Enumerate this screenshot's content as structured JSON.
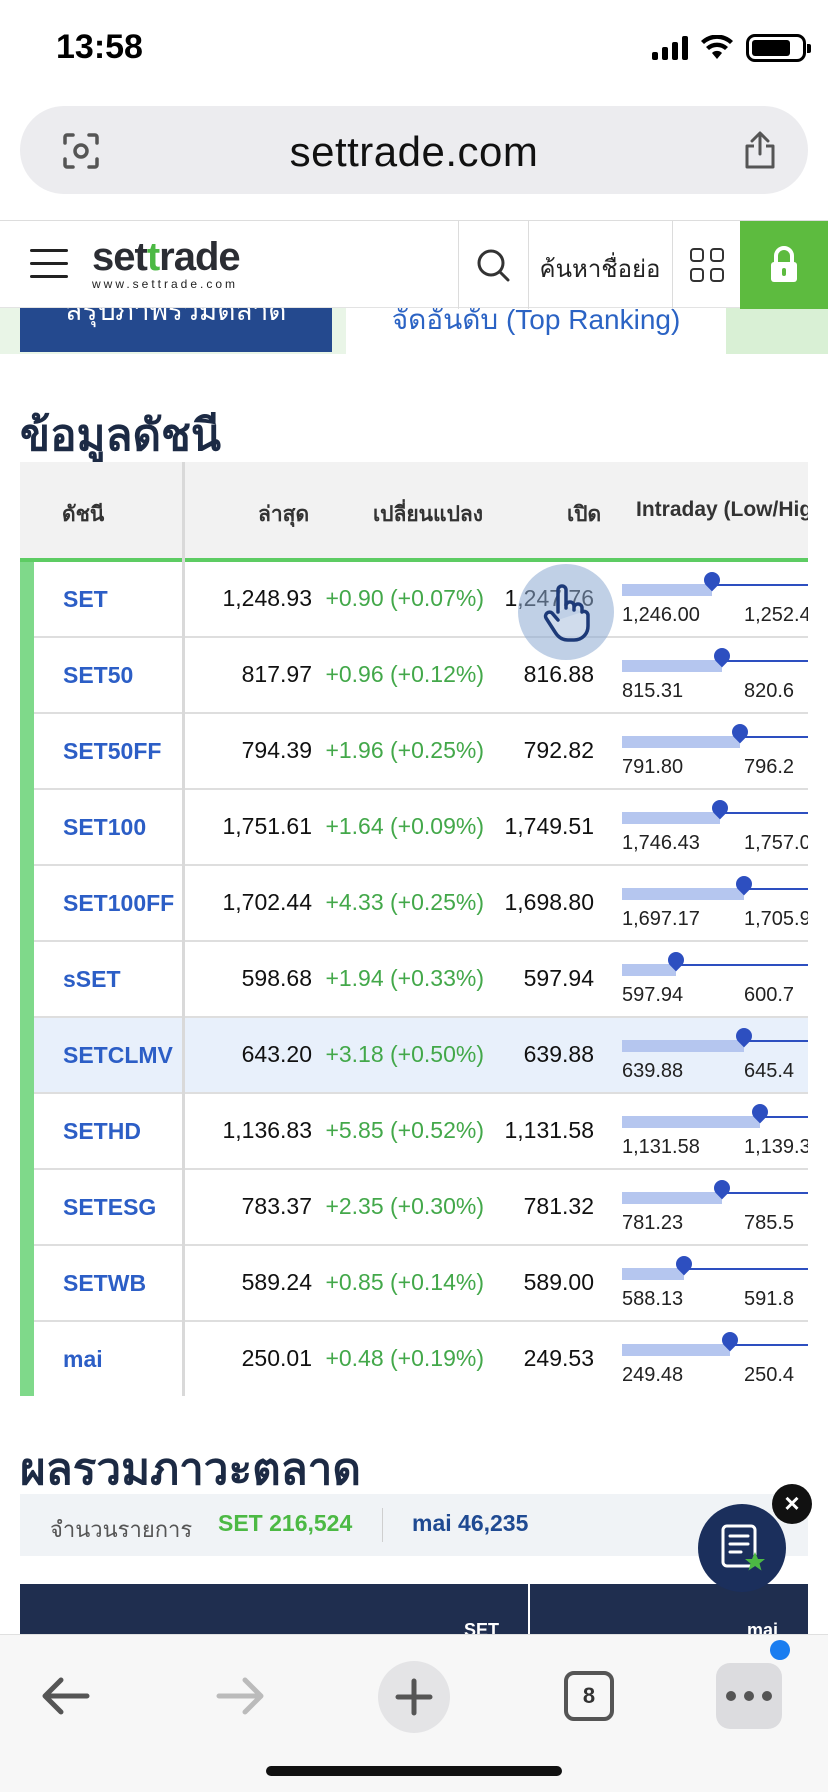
{
  "status_bar": {
    "time": "13:58"
  },
  "browser": {
    "url": "settrade.com",
    "tab_count": "8"
  },
  "site_header": {
    "logo_left": "set",
    "logo_mid": "t",
    "logo_right": "rade",
    "logo_sub": "www.settrade.com",
    "abbr_search_label": "ค้นหาชื่อย่อ"
  },
  "tabs": [
    {
      "label": "สรุปภาพรวมตลาด"
    },
    {
      "label": "จัดอันดับ (Top Ranking)"
    }
  ],
  "index_section": {
    "title": "ข้อมูลดัชนี",
    "headers": {
      "index": "ดัชนี",
      "last": "ล่าสุด",
      "change": "เปลี่ยนแปลง",
      "open": "เปิด",
      "intraday": "Intraday (Low/High)"
    },
    "rows": [
      {
        "name": "SET",
        "last": "1,248.93",
        "change": "+0.90 (+0.07%)",
        "open": "1,247.76",
        "low": "1,246.00",
        "high": "1,252.4",
        "position": 0.45
      },
      {
        "name": "SET50",
        "last": "817.97",
        "change": "+0.96 (+0.12%)",
        "open": "816.88",
        "low": "815.31",
        "high": "820.6",
        "position": 0.5
      },
      {
        "name": "SET50FF",
        "last": "794.39",
        "change": "+1.96 (+0.25%)",
        "open": "792.82",
        "low": "791.80",
        "high": "796.2",
        "position": 0.59
      },
      {
        "name": "SET100",
        "last": "1,751.61",
        "change": "+1.64 (+0.09%)",
        "open": "1,749.51",
        "low": "1,746.43",
        "high": "1,757.0",
        "position": 0.49
      },
      {
        "name": "SET100FF",
        "last": "1,702.44",
        "change": "+4.33 (+0.25%)",
        "open": "1,698.80",
        "low": "1,697.17",
        "high": "1,705.9",
        "position": 0.61
      },
      {
        "name": "sSET",
        "last": "598.68",
        "change": "+1.94 (+0.33%)",
        "open": "597.94",
        "low": "597.94",
        "high": "600.7",
        "position": 0.27
      },
      {
        "name": "SETCLMV",
        "last": "643.20",
        "change": "+3.18 (+0.50%)",
        "open": "639.88",
        "low": "639.88",
        "high": "645.4",
        "position": 0.61
      },
      {
        "name": "SETHD",
        "last": "1,136.83",
        "change": "+5.85 (+0.52%)",
        "open": "1,131.58",
        "low": "1,131.58",
        "high": "1,139.3",
        "position": 0.69
      },
      {
        "name": "SETESG",
        "last": "783.37",
        "change": "+2.35 (+0.30%)",
        "open": "781.32",
        "low": "781.23",
        "high": "785.5",
        "position": 0.5
      },
      {
        "name": "SETWB",
        "last": "589.24",
        "change": "+0.85 (+0.14%)",
        "open": "589.00",
        "low": "588.13",
        "high": "591.8",
        "position": 0.31
      },
      {
        "name": "mai",
        "last": "250.01",
        "change": "+0.48 (+0.19%)",
        "open": "249.53",
        "low": "249.48",
        "high": "250.4",
        "position": 0.54
      }
    ]
  },
  "market_summary": {
    "title": "ผลรวมภาวะตลาด",
    "label": "จำนวนรายการ",
    "set_value": "SET 216,524",
    "mai_value": "mai 46,235",
    "col_set": "SET",
    "col_mai": "mai"
  },
  "fab": {
    "close_label": "×"
  },
  "colors": {
    "accent_green": "#4cb944",
    "link_blue": "#2c5ec6",
    "navy": "#1f2e4f",
    "lock_green": "#5dbb3f"
  }
}
